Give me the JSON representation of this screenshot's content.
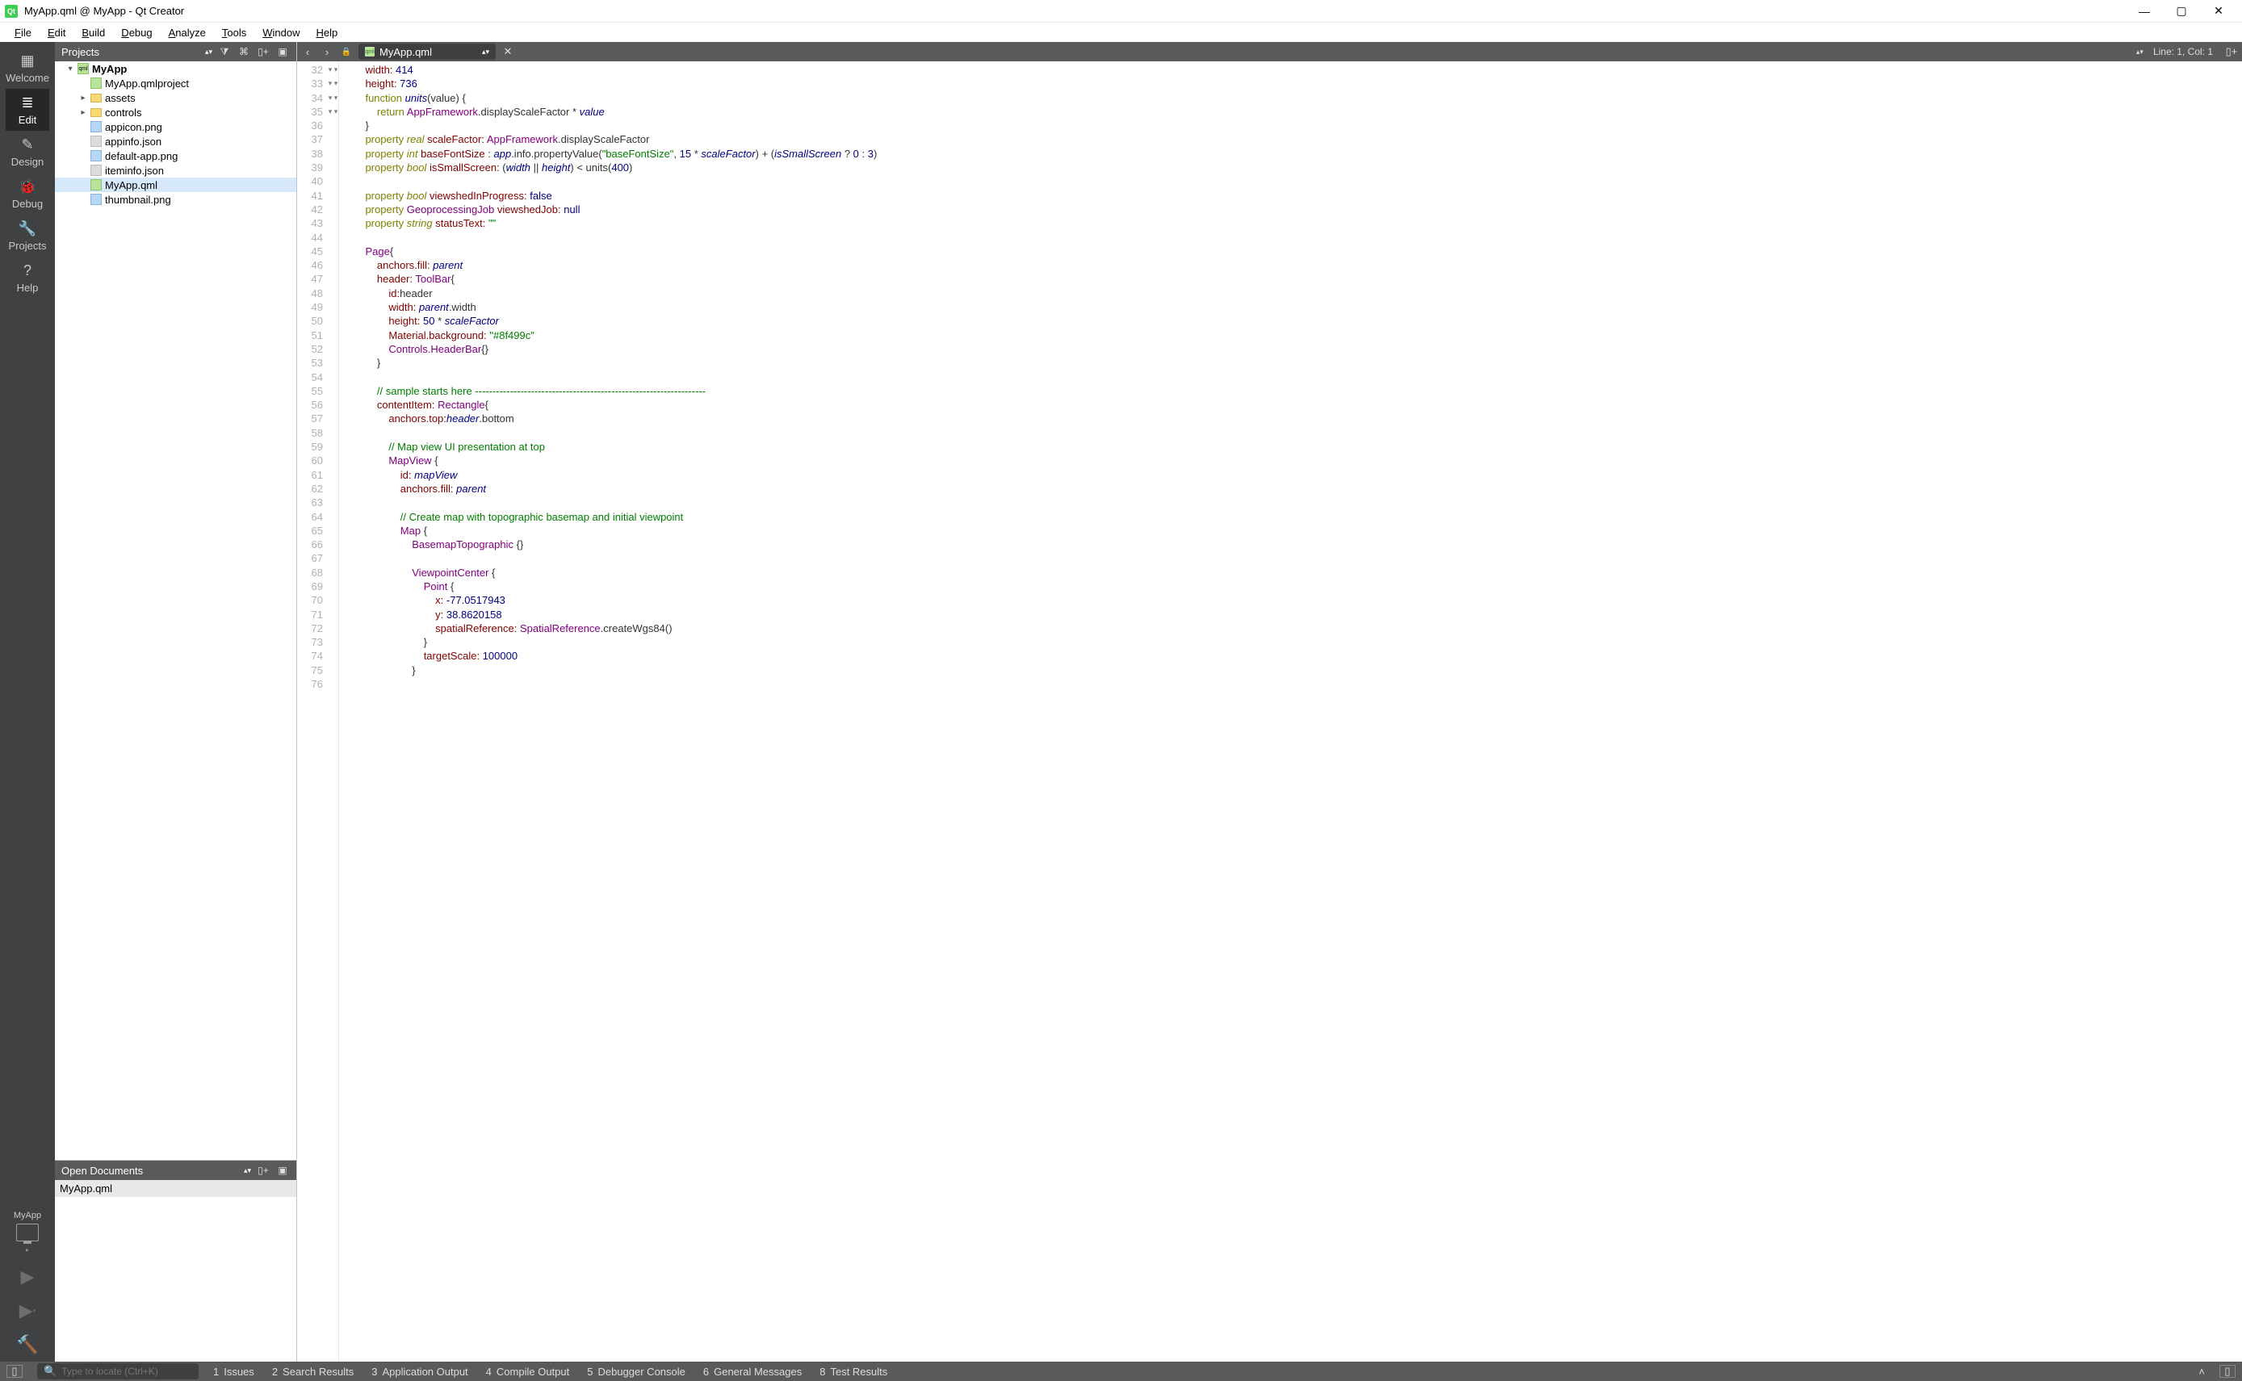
{
  "window": {
    "title": "MyApp.qml @ MyApp - Qt Creator"
  },
  "menus": [
    "File",
    "Edit",
    "Build",
    "Debug",
    "Analyze",
    "Tools",
    "Window",
    "Help"
  ],
  "rail": {
    "modes": [
      {
        "label": "Welcome",
        "icon": "▦"
      },
      {
        "label": "Edit",
        "icon": "≣",
        "active": true
      },
      {
        "label": "Design",
        "icon": "✎"
      },
      {
        "label": "Debug",
        "icon": "🐞"
      },
      {
        "label": "Projects",
        "icon": "🔧"
      },
      {
        "label": "Help",
        "icon": "?"
      }
    ],
    "kit": "MyApp"
  },
  "projects_panel": {
    "title": "Projects"
  },
  "tree": {
    "root": "MyApp",
    "children": [
      {
        "name": "MyApp.qmlproject",
        "type": "qml",
        "depth": 2
      },
      {
        "name": "assets",
        "type": "folder",
        "expandable": true,
        "depth": 2
      },
      {
        "name": "controls",
        "type": "folder",
        "expandable": true,
        "depth": 2
      },
      {
        "name": "appicon.png",
        "type": "png",
        "depth": 2
      },
      {
        "name": "appinfo.json",
        "type": "json",
        "depth": 2
      },
      {
        "name": "default-app.png",
        "type": "png",
        "depth": 2
      },
      {
        "name": "iteminfo.json",
        "type": "json",
        "depth": 2
      },
      {
        "name": "MyApp.qml",
        "type": "qml",
        "depth": 2,
        "selected": true
      },
      {
        "name": "thumbnail.png",
        "type": "png",
        "depth": 2
      }
    ]
  },
  "open_docs": {
    "title": "Open Documents",
    "items": [
      "MyApp.qml"
    ]
  },
  "editor": {
    "tab": "MyApp.qml",
    "status": "Line: 1, Col: 1",
    "first_line": 32,
    "fold_lines": [
      34,
      45,
      47,
      56,
      60,
      65,
      68,
      69
    ],
    "lines": [
      {
        "i": 2,
        "h": "<span class='prop'>width:</span> <span class='num'>414</span>"
      },
      {
        "i": 2,
        "h": "<span class='prop'>height:</span> <span class='num'>736</span>"
      },
      {
        "i": 2,
        "h": "<span class='kw'>function</span> <span class='val'>units</span>(value) {"
      },
      {
        "i": 3,
        "h": "<span class='kw'>return</span> <span class='type'>AppFramework</span>.displayScaleFactor * <span class='val'>value</span>"
      },
      {
        "i": 2,
        "h": "}"
      },
      {
        "i": 2,
        "h": "<span class='kw'>property</span> <span class='kw2'>real</span> <span class='prop'>scaleFactor:</span> <span class='type'>AppFramework</span>.displayScaleFactor"
      },
      {
        "i": 2,
        "h": "<span class='kw'>property</span> <span class='kw2'>int</span> <span class='prop'>baseFontSize</span> : <span class='val'>app</span>.info.propertyValue(<span class='str'>\"baseFontSize\"</span>, <span class='num'>15</span> * <span class='val'>scaleFactor</span>) + (<span class='val'>isSmallScreen</span> ? <span class='num'>0</span> : <span class='num'>3</span>)"
      },
      {
        "i": 2,
        "h": "<span class='kw'>property</span> <span class='kw2'>bool</span> <span class='prop'>isSmallScreen:</span> (<span class='val'>width</span> || <span class='val'>height</span>) &lt; units(<span class='num'>400</span>)"
      },
      {
        "i": 2,
        "h": ""
      },
      {
        "i": 2,
        "h": "<span class='kw'>property</span> <span class='kw2'>bool</span> <span class='prop'>viewshedInProgress:</span> <span class='num'>false</span>"
      },
      {
        "i": 2,
        "h": "<span class='kw'>property</span> <span class='type'>GeoprocessingJob</span> <span class='prop'>viewshedJob:</span> <span class='num'>null</span>"
      },
      {
        "i": 2,
        "h": "<span class='kw'>property</span> <span class='kw2'>string</span> <span class='prop'>statusText:</span> <span class='str'>\"\"</span>"
      },
      {
        "i": 2,
        "h": ""
      },
      {
        "i": 2,
        "h": "<span class='type'>Page</span>{"
      },
      {
        "i": 3,
        "h": "<span class='prop'>anchors.fill:</span> <span class='val'>parent</span>"
      },
      {
        "i": 3,
        "h": "<span class='prop'>header:</span> <span class='type'>ToolBar</span>{"
      },
      {
        "i": 4,
        "h": "<span class='prop'>id:</span>header"
      },
      {
        "i": 4,
        "h": "<span class='prop'>width:</span> <span class='val'>parent</span>.width"
      },
      {
        "i": 4,
        "h": "<span class='prop'>height:</span> <span class='num'>50</span> * <span class='val'>scaleFactor</span>"
      },
      {
        "i": 4,
        "h": "<span class='prop'>Material.background:</span> <span class='str'>\"#8f499c\"</span>"
      },
      {
        "i": 4,
        "h": "<span class='type'>Controls.HeaderBar</span>{}"
      },
      {
        "i": 3,
        "h": "}"
      },
      {
        "i": 3,
        "h": ""
      },
      {
        "i": 3,
        "h": "<span class='com'>// sample starts here ------------------------------------------------------------------</span>"
      },
      {
        "i": 3,
        "h": "<span class='prop'>contentItem:</span> <span class='type'>Rectangle</span>{"
      },
      {
        "i": 4,
        "h": "<span class='prop'>anchors.top:</span><span class='val'>header</span>.bottom"
      },
      {
        "i": 4,
        "h": ""
      },
      {
        "i": 4,
        "h": "<span class='com'>// Map view UI presentation at top</span>"
      },
      {
        "i": 4,
        "h": "<span class='type'>MapView</span> {"
      },
      {
        "i": 5,
        "h": "<span class='prop'>id:</span> <span class='val'>mapView</span>"
      },
      {
        "i": 5,
        "h": "<span class='prop'>anchors.fill:</span> <span class='val'>parent</span>"
      },
      {
        "i": 5,
        "h": ""
      },
      {
        "i": 5,
        "h": "<span class='com'>// Create map with topographic basemap and initial viewpoint</span>"
      },
      {
        "i": 5,
        "h": "<span class='type'>Map</span> {"
      },
      {
        "i": 6,
        "h": "<span class='type'>BasemapTopographic</span> {}"
      },
      {
        "i": 6,
        "h": ""
      },
      {
        "i": 6,
        "h": "<span class='type'>ViewpointCenter</span> {"
      },
      {
        "i": 7,
        "h": "<span class='type'>Point</span> {"
      },
      {
        "i": 8,
        "h": "<span class='prop'>x:</span> <span class='num'>-77.0517943</span>"
      },
      {
        "i": 8,
        "h": "<span class='prop'>y:</span> <span class='num'>38.8620158</span>"
      },
      {
        "i": 8,
        "h": "<span class='prop'>spatialReference:</span> <span class='type'>SpatialReference</span>.createWgs84()"
      },
      {
        "i": 7,
        "h": "}"
      },
      {
        "i": 7,
        "h": "<span class='prop'>targetScale:</span> <span class='num'>100000</span>"
      },
      {
        "i": 6,
        "h": "}"
      },
      {
        "i": 5,
        "h": ""
      }
    ]
  },
  "locator": {
    "placeholder": "Type to locate (Ctrl+K)"
  },
  "output_tabs": [
    {
      "n": "1",
      "label": "Issues"
    },
    {
      "n": "2",
      "label": "Search Results"
    },
    {
      "n": "3",
      "label": "Application Output"
    },
    {
      "n": "4",
      "label": "Compile Output"
    },
    {
      "n": "5",
      "label": "Debugger Console"
    },
    {
      "n": "6",
      "label": "General Messages"
    },
    {
      "n": "8",
      "label": "Test Results"
    }
  ]
}
